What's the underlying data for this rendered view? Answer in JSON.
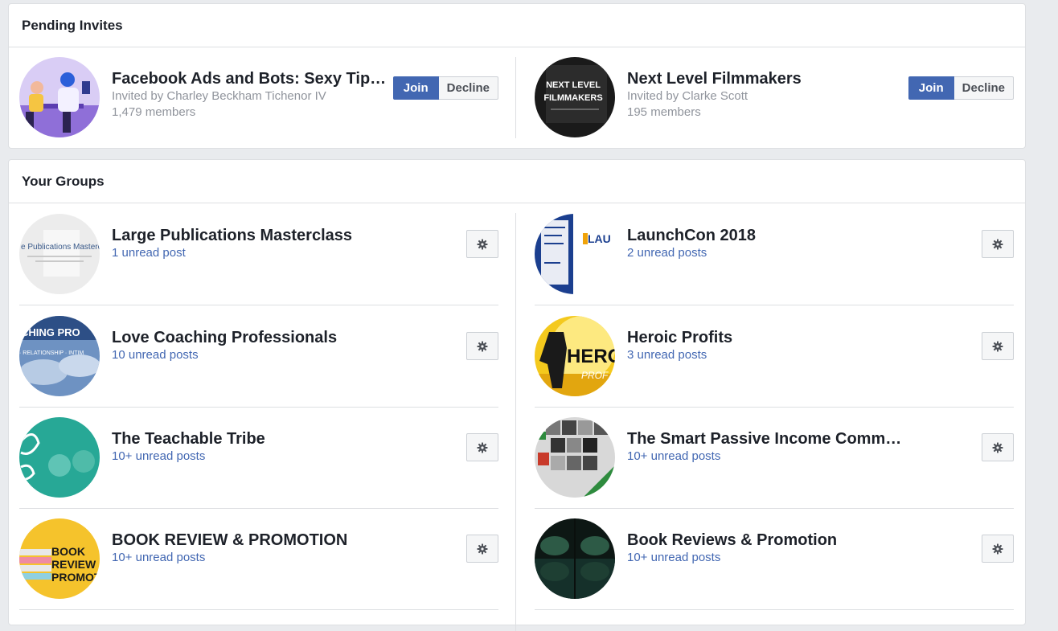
{
  "pending": {
    "title": "Pending Invites",
    "join_label": "Join",
    "decline_label": "Decline",
    "invites": [
      {
        "name": "Facebook Ads and Bots: Sexy Tip…",
        "invited_by": "Invited by Charley Beckham Tichenor IV",
        "members": "1,479 members"
      },
      {
        "name": "Next Level Filmmakers",
        "invited_by": "Invited by Clarke Scott",
        "members": "195 members",
        "avatar_text": [
          "NEXT LEVEL",
          "FILMMAKERS"
        ]
      }
    ]
  },
  "groups": {
    "title": "Your Groups",
    "items": [
      {
        "name": "Large Publications Masterclass",
        "unread": "1 unread post",
        "avatar_text": "e Publications Masterc"
      },
      {
        "name": "LaunchCon 2018",
        "unread": "2 unread posts",
        "avatar_text": "LAU"
      },
      {
        "name": "Love Coaching Professionals",
        "unread": "10 unread posts",
        "avatar_text": [
          "CHING PRO",
          "· RELATIONSHIP · INTIM"
        ]
      },
      {
        "name": "Heroic Profits",
        "unread": "3 unread posts",
        "avatar_text": [
          "HERO",
          "PROF"
        ]
      },
      {
        "name": "The Teachable Tribe",
        "unread": "10+ unread posts"
      },
      {
        "name": "The Smart Passive Income Community",
        "unread": "10+ unread posts"
      },
      {
        "name": "BOOK REVIEW & PROMOTION",
        "unread": "10+ unread posts",
        "avatar_text": [
          "BOOK",
          "REVIEW &",
          "PROMOTI"
        ]
      },
      {
        "name": "Book Reviews & Promotion",
        "unread": "10+ unread posts"
      }
    ]
  },
  "colors": {
    "accent": "#4267b2",
    "page_bg": "#e9ebee",
    "border": "#dddfe2",
    "muted_text": "#90949c"
  },
  "icons": {
    "settings": "gear-icon"
  }
}
